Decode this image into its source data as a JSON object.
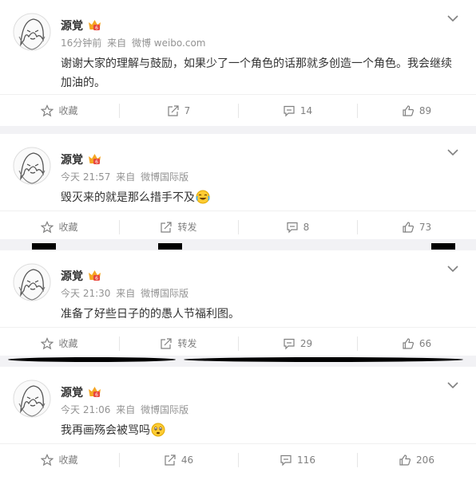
{
  "posts": [
    {
      "author": "源覚",
      "time": "16分钟前",
      "source_prefix": "来自",
      "source": "微博 weibo.com",
      "text": "谢谢大家的理解与鼓励，如果少了一个角色的话那就多创造一个角色。我会继续加油的。",
      "emoji": "",
      "actions": {
        "favorite": "收藏",
        "repost": "7",
        "comment": "14",
        "like": "89"
      }
    },
    {
      "author": "源覚",
      "time": "今天 21:57",
      "source_prefix": "来自",
      "source": "微博国际版",
      "text": "毁灭来的就是那么措手不及",
      "emoji": "crying-laughing-emoji",
      "actions": {
        "favorite": "收藏",
        "repost": "转发",
        "comment": "8",
        "like": "73"
      }
    },
    {
      "author": "源覚",
      "time": "今天 21:30",
      "source_prefix": "来自",
      "source": "微博国际版",
      "text": "准备了好些日子的的愚人节福利图。",
      "emoji": "",
      "actions": {
        "favorite": "收藏",
        "repost": "转发",
        "comment": "29",
        "like": "66"
      }
    },
    {
      "author": "源覚",
      "time": "今天 21:06",
      "source_prefix": "来自",
      "source": "微博国际版",
      "text": "我再画殇会被骂吗",
      "emoji": "worried-face-emoji",
      "actions": {
        "favorite": "收藏",
        "repost": "46",
        "comment": "116",
        "like": "206"
      }
    }
  ],
  "colors": {
    "accent": "#ff8200",
    "text": "#333333",
    "meta": "#939393",
    "badge": "#f5a623"
  }
}
